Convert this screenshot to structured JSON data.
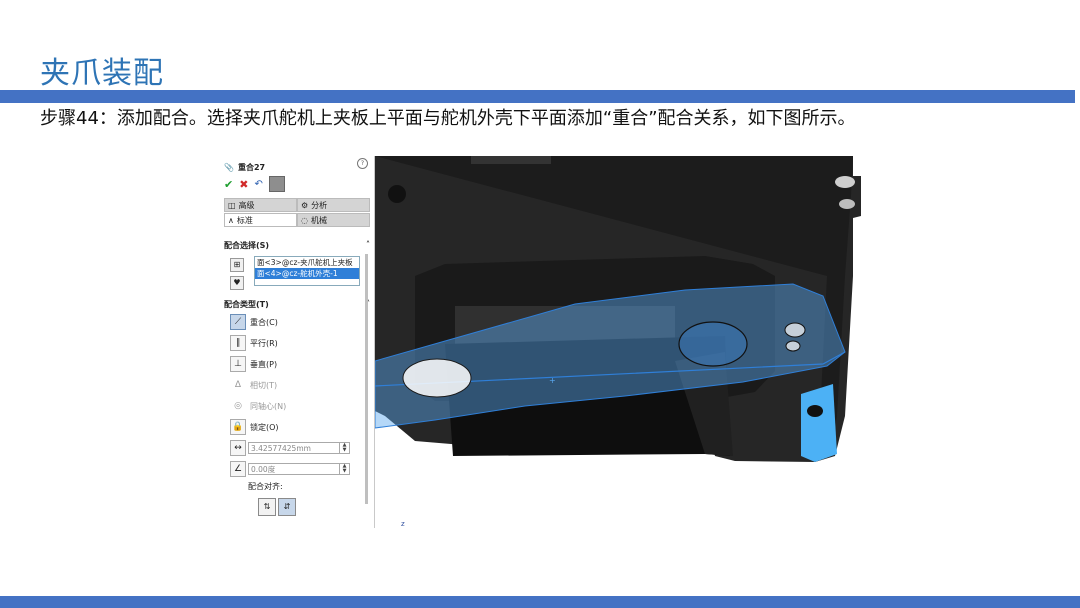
{
  "slide": {
    "title": "夹爪装配",
    "step_text": "步骤44：添加配合。选择夹爪舵机上夹板上平面与舵机外壳下平面添加“重合”配合关系，如下图所示。",
    "accent_color": "#4472c4",
    "title_color": "#2e74b5"
  },
  "property_manager": {
    "title": "重合27",
    "title_icon": "paperclip-icon",
    "help_label": "?",
    "tabs_row1": [
      {
        "label": "高级",
        "icon": "advanced-icon"
      },
      {
        "label": "分析",
        "icon": "analysis-icon"
      }
    ],
    "tabs_row2": [
      {
        "label": "标准",
        "icon": "standard-icon"
      },
      {
        "label": "机械",
        "icon": "mechanical-icon"
      }
    ],
    "selection_section": "配合选择(S)",
    "selections": [
      "面<3>@cz-夹爪舵机上夹板",
      "面<4>@cz-舵机外壳-1"
    ],
    "type_section": "配合类型(T)",
    "mate_types": [
      {
        "label": "重合(C)",
        "icon": "coincident-icon",
        "selected": true,
        "enabled": true
      },
      {
        "label": "平行(R)",
        "icon": "parallel-icon",
        "selected": false,
        "enabled": true
      },
      {
        "label": "垂直(P)",
        "icon": "perpendicular-icon",
        "selected": false,
        "enabled": true
      },
      {
        "label": "相切(T)",
        "icon": "tangent-icon",
        "selected": false,
        "enabled": false
      },
      {
        "label": "同轴心(N)",
        "icon": "concentric-icon",
        "selected": false,
        "enabled": false
      },
      {
        "label": "锁定(O)",
        "icon": "lock-icon",
        "selected": false,
        "enabled": true
      }
    ],
    "distance_value": "3.42577425mm",
    "angle_value": "0.00度",
    "alignment_label": "配合对齐:"
  },
  "viewport": {
    "triad_label": "z"
  }
}
